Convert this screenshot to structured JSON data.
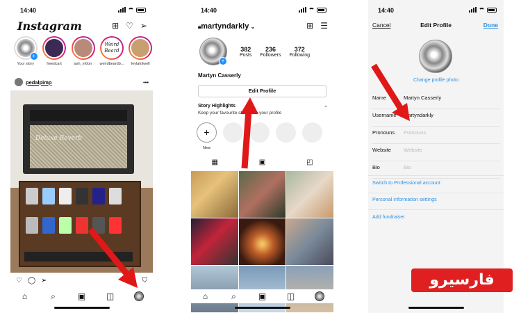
{
  "status": {
    "time": "14:40"
  },
  "feed": {
    "logo": "Instagram",
    "stories": [
      {
        "label": "Your story",
        "you": true
      },
      {
        "label": "heedcart"
      },
      {
        "label": "ash_m0on"
      },
      {
        "label": "weirdbeardb..."
      },
      {
        "label": "leylafolwell"
      }
    ],
    "post_user": "pedalpimp",
    "amp_logo": "Deluxe Reverb"
  },
  "profile": {
    "username": "martyndarkly",
    "posts_value": "382",
    "posts_label": "Posts",
    "followers_value": "236",
    "followers_label": "Followers",
    "following_value": "372",
    "following_label": "Following",
    "full_name": "Martyn Casserly",
    "edit_button": "Edit Profile",
    "highlights_title": "Story Highlights",
    "highlights_subtitle": "Keep your favourite stories on your profile",
    "new_label": "New"
  },
  "edit": {
    "cancel": "Cancel",
    "title": "Edit Profile",
    "done": "Done",
    "change_photo": "Change profile photo",
    "fields": [
      {
        "label": "Name",
        "value": "Martyn Casserly",
        "placeholder": false
      },
      {
        "label": "Username",
        "value": "martyndarkly",
        "placeholder": false
      },
      {
        "label": "Pronouns",
        "value": "Pronouns",
        "placeholder": true
      },
      {
        "label": "Website",
        "value": "Website",
        "placeholder": true
      },
      {
        "label": "Bio",
        "value": "Bio",
        "placeholder": true
      }
    ],
    "links": [
      "Switch to Professional account",
      "Personal information settings",
      "Add fundraiser"
    ]
  },
  "watermark": "فارسیرو",
  "colors": {
    "accent_blue": "#2b8fe0",
    "arrow_red": "#e01818",
    "watermark_red": "#e02020"
  },
  "icons": [
    "plus-square-icon",
    "heart-icon",
    "send-icon",
    "home-icon",
    "search-icon",
    "reels-icon",
    "shop-icon",
    "menu-icon",
    "grid-icon",
    "bookmark-icon",
    "comment-icon",
    "tag-icon",
    "chevron-down-icon",
    "lock-icon"
  ]
}
